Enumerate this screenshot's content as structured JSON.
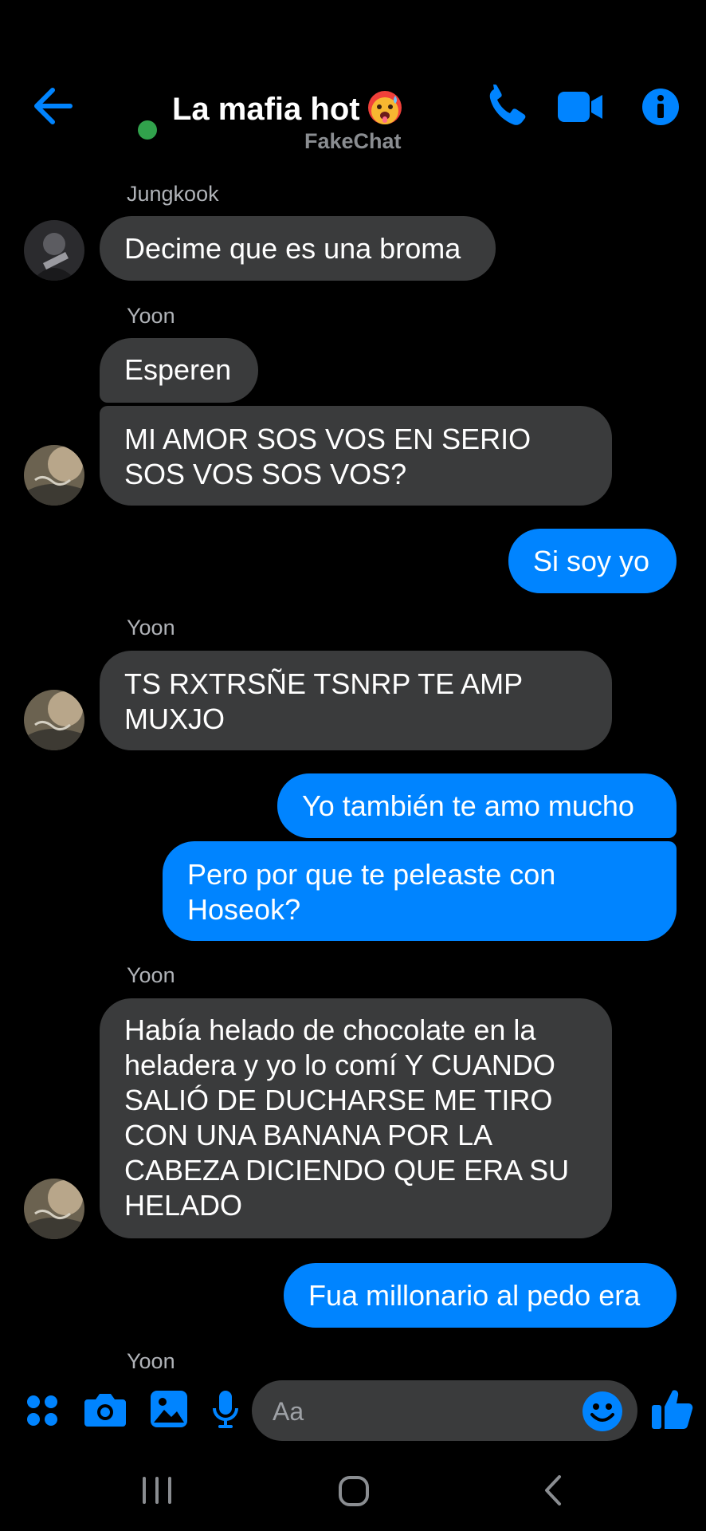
{
  "header": {
    "title": "La mafia hot",
    "subtitle": "FakeChat",
    "emoji_icon": "hot-face-emoji",
    "accent_color": "#0084ff",
    "online_color": "#31a24c"
  },
  "messages": [
    {
      "sender": "Jungkook",
      "text": "Decime que es una broma"
    },
    {
      "sender": "Yoon",
      "text": "Esperen"
    },
    {
      "text": "MI AMOR SOS VOS EN SERIO SOS VOS SOS VOS?"
    },
    {
      "text": "Si soy yo"
    },
    {
      "sender": "Yoon",
      "text": "TS RXTRSÑE TSNRP TE AMP MUXJO"
    },
    {
      "text": "Yo también te amo mucho"
    },
    {
      "text": "Pero por que te peleaste con Hoseok?"
    },
    {
      "sender": "Yoon",
      "text": "Había helado de chocolate en la heladera y yo lo comí Y CUANDO SALIÓ DE DUCHARSE ME TIRO CON UNA BANANA POR LA CABEZA DICIENDO QUE ERA SU HELADO"
    },
    {
      "text": "Fua millonario al pedo era"
    },
    {
      "sender": "Yoon"
    }
  ],
  "composer": {
    "placeholder": "Aa",
    "icons": [
      "menu-dots-icon",
      "camera-icon",
      "gallery-icon",
      "microphone-icon",
      "emoji-icon",
      "like-icon"
    ]
  },
  "navbar": {
    "icons": [
      "recent-apps-icon",
      "home-icon",
      "back-icon"
    ]
  }
}
